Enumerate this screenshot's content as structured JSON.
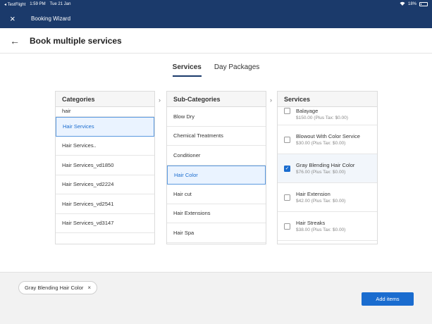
{
  "statusbar": {
    "carrier": "◂ TestFlight",
    "time": "1:59 PM",
    "date": "Tue 21 Jan",
    "battery": "18%"
  },
  "navbar": {
    "close_icon": "×",
    "title": "Booking Wizard"
  },
  "header": {
    "back_icon": "←",
    "title": "Book multiple services"
  },
  "tabs": [
    {
      "label": "Services",
      "active": true
    },
    {
      "label": "Day Packages",
      "active": false
    }
  ],
  "categories": {
    "header": "Categories",
    "items": [
      "hair",
      "Hair Services",
      "Hair Services..",
      "Hair Services_vd1850",
      "Hair Services_vd2224",
      "Hair Services_vd2541",
      "Hair Services_vd3147"
    ],
    "selected": "Hair Services"
  },
  "subcategories": {
    "header": "Sub-Categories",
    "items": [
      "Blow Dry",
      "Chemical Treatments",
      "Conditioner",
      "Hair Color",
      "Hair cut",
      "Hair Extensions",
      "Hair Spa"
    ],
    "selected": "Hair Color"
  },
  "services": {
    "header": "Services",
    "items": [
      {
        "name": "Balayage",
        "price": "$150.00 (Plus Tax: $0.00)",
        "checked": false
      },
      {
        "name": "Blowout With Color Service",
        "price": "$30.00 (Plus Tax: $0.00)",
        "checked": false
      },
      {
        "name": "Gray Blending Hair Color",
        "price": "$76.00 (Plus Tax: $0.00)",
        "checked": true
      },
      {
        "name": "Hair Extension",
        "price": "$42.00 (Plus Tax: $0.00)",
        "checked": false
      },
      {
        "name": "Hair Streaks",
        "price": "$38.00 (Plus Tax: $0.00)",
        "checked": false
      }
    ]
  },
  "footer": {
    "chip_label": "Gray Blending Hair Color",
    "chip_remove_icon": "×",
    "add_button": "Add items"
  }
}
